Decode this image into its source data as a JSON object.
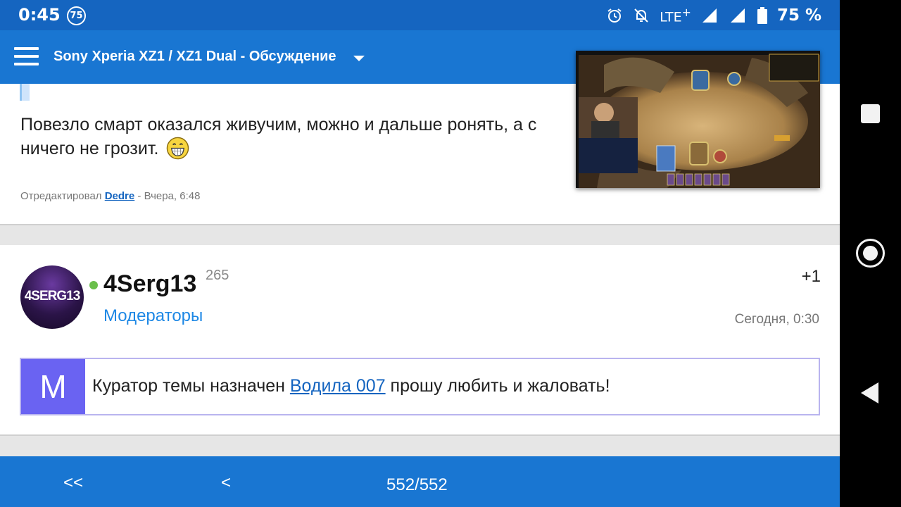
{
  "status_bar": {
    "time": "0:45",
    "notification_badge": "75",
    "network": "LTE",
    "battery_percent": "75 %"
  },
  "app_bar": {
    "title": "Sony Xperia XZ1 / XZ1 Dual - Обсуждение"
  },
  "post_previous": {
    "text": "Повезло смарт оказался живучим, можно и дальше ронять, а с ничего не грозит.",
    "edited_prefix": "Отредактировал",
    "edited_user": "Dedre",
    "edited_time": "- Вчера, 6:48"
  },
  "post": {
    "avatar_text": "4SERG13",
    "username": "4Serg13",
    "reputation": "265",
    "group": "Модераторы",
    "plus_label": "+1",
    "time": "Сегодня, 0:30",
    "mod_letter": "M",
    "mod_text_before": "Куратор темы назначен ",
    "mod_link": "Водила 007",
    "mod_text_after": " прошу любить и жаловать!"
  },
  "pagination": {
    "first": "<<",
    "prev": "<",
    "pages": "552/552"
  },
  "colors": {
    "status_bar": "#1565c0",
    "app_bar": "#1976d2",
    "moderator_accent": "#6a63f2",
    "link": "#1565c0",
    "group": "#1e88e5",
    "online": "#6abf4b"
  }
}
